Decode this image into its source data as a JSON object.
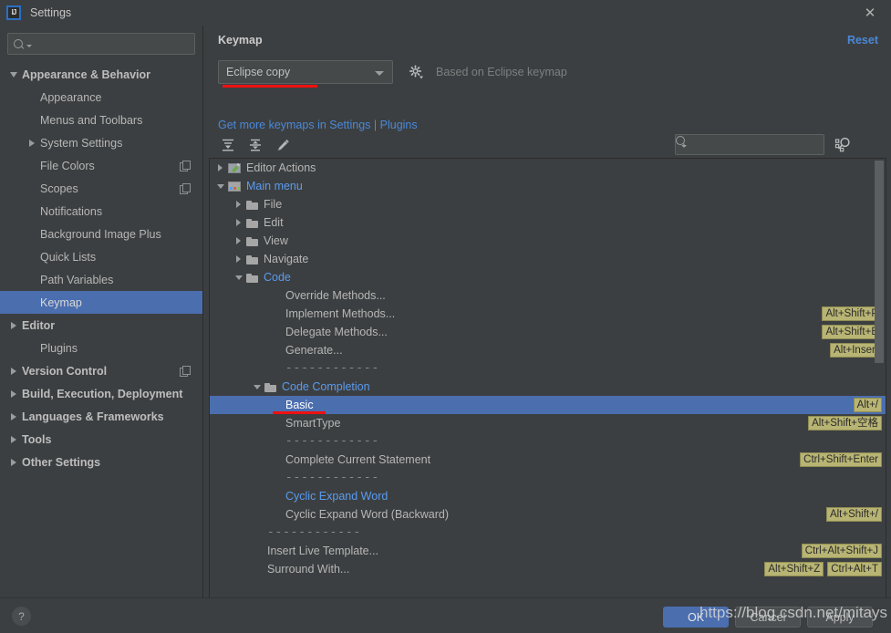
{
  "window": {
    "title": "Settings",
    "logo_text": "IJ",
    "close_icon": "close-icon"
  },
  "sidebar": {
    "search": {
      "value": "",
      "placeholder": ""
    },
    "items": [
      {
        "label": "Appearance & Behavior",
        "level": 0,
        "arrow": "down",
        "bold": true,
        "selected": false,
        "copy": false
      },
      {
        "label": "Appearance",
        "level": 1,
        "arrow": "none",
        "bold": false,
        "selected": false,
        "copy": false
      },
      {
        "label": "Menus and Toolbars",
        "level": 1,
        "arrow": "none",
        "bold": false,
        "selected": false,
        "copy": false
      },
      {
        "label": "System Settings",
        "level": 1,
        "arrow": "right",
        "bold": false,
        "selected": false,
        "copy": false
      },
      {
        "label": "File Colors",
        "level": 1,
        "arrow": "none",
        "bold": false,
        "selected": false,
        "copy": true
      },
      {
        "label": "Scopes",
        "level": 1,
        "arrow": "none",
        "bold": false,
        "selected": false,
        "copy": true
      },
      {
        "label": "Notifications",
        "level": 1,
        "arrow": "none",
        "bold": false,
        "selected": false,
        "copy": false
      },
      {
        "label": "Background Image Plus",
        "level": 1,
        "arrow": "none",
        "bold": false,
        "selected": false,
        "copy": false
      },
      {
        "label": "Quick Lists",
        "level": 1,
        "arrow": "none",
        "bold": false,
        "selected": false,
        "copy": false
      },
      {
        "label": "Path Variables",
        "level": 1,
        "arrow": "none",
        "bold": false,
        "selected": false,
        "copy": false
      },
      {
        "label": "Keymap",
        "level": 1,
        "arrow": "none",
        "bold": true,
        "selected": true,
        "copy": false
      },
      {
        "label": "Editor",
        "level": 0,
        "arrow": "right",
        "bold": true,
        "selected": false,
        "copy": false
      },
      {
        "label": "Plugins",
        "level": 1,
        "arrow": "none",
        "bold": true,
        "selected": false,
        "copy": false
      },
      {
        "label": "Version Control",
        "level": 0,
        "arrow": "right",
        "bold": true,
        "selected": false,
        "copy": true
      },
      {
        "label": "Build, Execution, Deployment",
        "level": 0,
        "arrow": "right",
        "bold": true,
        "selected": false,
        "copy": false
      },
      {
        "label": "Languages & Frameworks",
        "level": 0,
        "arrow": "right",
        "bold": true,
        "selected": false,
        "copy": false
      },
      {
        "label": "Tools",
        "level": 0,
        "arrow": "right",
        "bold": true,
        "selected": false,
        "copy": false
      },
      {
        "label": "Other Settings",
        "level": 0,
        "arrow": "right",
        "bold": true,
        "selected": false,
        "copy": false
      }
    ]
  },
  "panel": {
    "title": "Keymap",
    "reset_label": "Reset",
    "keymap_combo": {
      "value": "Eclipse copy",
      "annotation_color": "#ee1111"
    },
    "gear_icon": "gear-icon",
    "based_on": "Based on Eclipse keymap",
    "plugins_link": "Get more keymaps in Settings | Plugins",
    "toolbar": {
      "expand_all": "expand-all-icon",
      "collapse_all": "collapse-all-icon",
      "edit": "edit-pencil-icon",
      "search": {
        "value": "",
        "placeholder": ""
      },
      "find_by_shortcut": "find-by-shortcut-icon"
    }
  },
  "tree": {
    "selection_color": "#4b6eaf",
    "shortcut_badge_color": "#b8b473",
    "rows": [
      {
        "label": "Editor Actions",
        "indent": 0,
        "arrow": "right",
        "icon": "editor-actions-icon",
        "blue": false,
        "selected": false,
        "shortcuts": []
      },
      {
        "label": "Main menu",
        "indent": 0,
        "arrow": "down",
        "icon": "main-menu-icon",
        "blue": true,
        "selected": false,
        "shortcuts": []
      },
      {
        "label": "File",
        "indent": 1,
        "arrow": "right",
        "icon": "folder-icon",
        "blue": false,
        "selected": false,
        "shortcuts": []
      },
      {
        "label": "Edit",
        "indent": 1,
        "arrow": "right",
        "icon": "folder-icon",
        "blue": false,
        "selected": false,
        "shortcuts": []
      },
      {
        "label": "View",
        "indent": 1,
        "arrow": "right",
        "icon": "folder-icon",
        "blue": false,
        "selected": false,
        "shortcuts": []
      },
      {
        "label": "Navigate",
        "indent": 1,
        "arrow": "right",
        "icon": "folder-icon",
        "blue": false,
        "selected": false,
        "shortcuts": []
      },
      {
        "label": "Code",
        "indent": 1,
        "arrow": "down",
        "icon": "folder-icon",
        "blue": true,
        "selected": false,
        "shortcuts": []
      },
      {
        "label": "Override Methods...",
        "indent": 3,
        "arrow": "none",
        "icon": "none",
        "blue": false,
        "selected": false,
        "shortcuts": []
      },
      {
        "label": "Implement Methods...",
        "indent": 3,
        "arrow": "none",
        "icon": "none",
        "blue": false,
        "selected": false,
        "shortcuts": [
          "Alt+Shift+P"
        ]
      },
      {
        "label": "Delegate Methods...",
        "indent": 3,
        "arrow": "none",
        "icon": "none",
        "blue": false,
        "selected": false,
        "shortcuts": [
          "Alt+Shift+E"
        ]
      },
      {
        "label": "Generate...",
        "indent": 3,
        "arrow": "none",
        "icon": "none",
        "blue": false,
        "selected": false,
        "shortcuts": [
          "Alt+Insert"
        ]
      },
      {
        "label": "------------",
        "indent": 3,
        "arrow": "none",
        "icon": "none",
        "blue": false,
        "selected": false,
        "separator": true,
        "shortcuts": []
      },
      {
        "label": "Code Completion",
        "indent": 2,
        "arrow": "down",
        "icon": "folder-icon",
        "blue": true,
        "selected": false,
        "shortcuts": []
      },
      {
        "label": "Basic",
        "indent": 3,
        "arrow": "none",
        "icon": "none",
        "blue": false,
        "selected": true,
        "shortcuts": [
          "Alt+/"
        ]
      },
      {
        "label": "SmartType",
        "indent": 3,
        "arrow": "none",
        "icon": "none",
        "blue": false,
        "selected": false,
        "shortcuts": [
          "Alt+Shift+空格"
        ]
      },
      {
        "label": "------------",
        "indent": 3,
        "arrow": "none",
        "icon": "none",
        "blue": false,
        "selected": false,
        "separator": true,
        "shortcuts": []
      },
      {
        "label": "Complete Current Statement",
        "indent": 3,
        "arrow": "none",
        "icon": "none",
        "blue": false,
        "selected": false,
        "shortcuts": [
          "Ctrl+Shift+Enter"
        ]
      },
      {
        "label": "------------",
        "indent": 3,
        "arrow": "none",
        "icon": "none",
        "blue": false,
        "selected": false,
        "separator": true,
        "shortcuts": []
      },
      {
        "label": "Cyclic Expand Word",
        "indent": 3,
        "arrow": "none",
        "icon": "none",
        "blue": true,
        "selected": false,
        "shortcuts": []
      },
      {
        "label": "Cyclic Expand Word (Backward)",
        "indent": 3,
        "arrow": "none",
        "icon": "none",
        "blue": false,
        "selected": false,
        "shortcuts": [
          "Alt+Shift+/"
        ]
      },
      {
        "label": "------------",
        "indent": 2,
        "arrow": "none",
        "icon": "none",
        "blue": false,
        "selected": false,
        "separator": true,
        "shortcuts": []
      },
      {
        "label": "Insert Live Template...",
        "indent": 2,
        "arrow": "none",
        "icon": "none",
        "blue": false,
        "selected": false,
        "shortcuts": [
          "Ctrl+Alt+Shift+J"
        ]
      },
      {
        "label": "Surround With...",
        "indent": 2,
        "arrow": "none",
        "icon": "none",
        "blue": false,
        "selected": false,
        "shortcuts": [
          "Alt+Shift+Z",
          "Ctrl+Alt+T"
        ]
      }
    ]
  },
  "bottom": {
    "help_label": "?",
    "ok_label": "OK",
    "cancel_label": "Cancel",
    "apply_label": "Apply"
  },
  "watermark": "https://blog.csdn.net/mitays"
}
